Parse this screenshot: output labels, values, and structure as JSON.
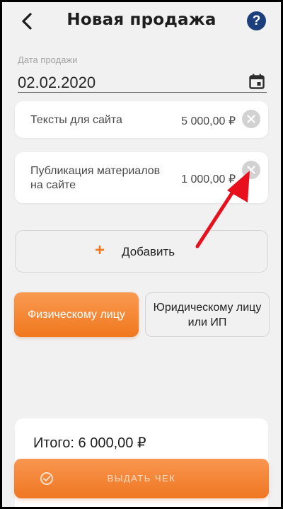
{
  "header": {
    "title": "Новая продажа",
    "back_icon": "chevron-left-icon",
    "help_label": "?",
    "help_color": "#1c3e7c"
  },
  "sale_date": {
    "label": "Дата продажи",
    "value": "02.02.2020",
    "icon": "calendar-icon"
  },
  "items": [
    {
      "name": "Тексты для сайта",
      "price": "5 000,00 ₽"
    },
    {
      "name": "Публикация материалов на сайте",
      "price": "1 000,00 ₽"
    }
  ],
  "add_button": {
    "label": "Добавить",
    "icon": "+"
  },
  "client_type": {
    "individual": "Физическому лицу",
    "legal": "Юридическому лицу или ИП",
    "selected": "individual"
  },
  "total": {
    "label": "Итого: 6 000,00 ₽"
  },
  "issue_button": {
    "label": "ВЫДАТЬ ЧЕК",
    "icon": "check-circle-icon"
  },
  "colors": {
    "accent": "#f07a22",
    "annotation": "#e8101c"
  }
}
